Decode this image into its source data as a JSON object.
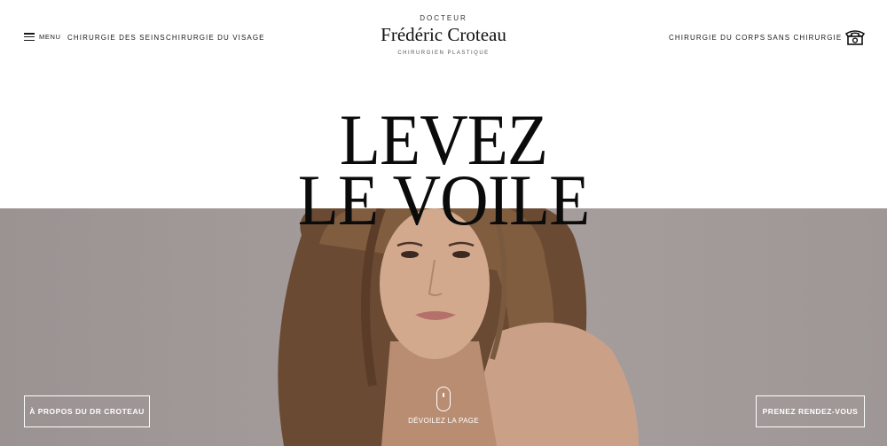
{
  "nav": {
    "menu_label": "MENU",
    "left_links": [
      "CHIRURGIE DES SEINS",
      "CHIRURGIE DU VISAGE"
    ],
    "right_links": [
      "CHIRURGIE DU CORPS",
      "SANS CHIRURGIE"
    ],
    "phone_icon": "telephone-icon"
  },
  "brand": {
    "top": "DOCTEUR",
    "name": "Frédéric Croteau",
    "subtitle": "CHIRURGIEN PLASTIQUE"
  },
  "hero": {
    "headline_line1": "LEVEZ",
    "headline_line2": "LE VOILE",
    "about_button": "À PROPOS DU DR CROTEAU",
    "appointment_button": "PRENEZ RENDEZ-VOUS",
    "scroll_label": "DÉVOILEZ LA PAGE",
    "scroll_icon": "mouse-scroll-icon"
  },
  "colors": {
    "hero_background": "#a39b99",
    "text": "#1a1a1a",
    "button_outline": "#ffffff"
  }
}
